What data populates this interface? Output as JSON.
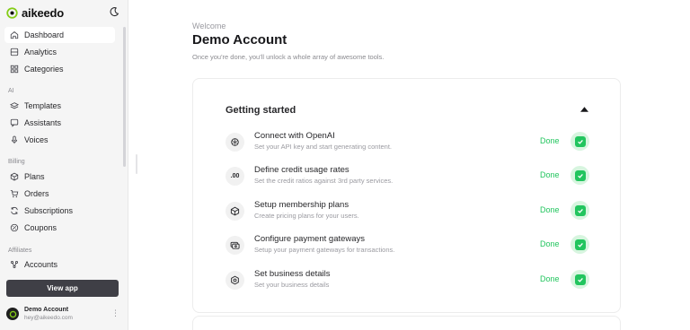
{
  "brand": {
    "name": "aikeedo"
  },
  "sidebar": {
    "items": [
      {
        "label": "Dashboard",
        "icon": "home-icon"
      },
      {
        "label": "Analytics",
        "icon": "chart-icon"
      },
      {
        "label": "Categories",
        "icon": "grid-icon"
      },
      {
        "label": "Templates",
        "icon": "layers-icon"
      },
      {
        "label": "Assistants",
        "icon": "chat-icon"
      },
      {
        "label": "Voices",
        "icon": "mic-icon"
      },
      {
        "label": "Plans",
        "icon": "box-icon"
      },
      {
        "label": "Orders",
        "icon": "cart-icon"
      },
      {
        "label": "Subscriptions",
        "icon": "refresh-icon"
      },
      {
        "label": "Coupons",
        "icon": "coupon-icon"
      },
      {
        "label": "Accounts",
        "icon": "share-icon"
      }
    ],
    "sections": {
      "ai": "AI",
      "billing": "Billing",
      "affiliates": "Affiliates"
    },
    "view_app": "View app",
    "user": {
      "name": "Demo Account",
      "email": "hey@aikeedo.com"
    }
  },
  "main": {
    "welcome": "Welcome",
    "title": "Demo Account",
    "subtitle": "Once you're done, you'll unlock a whole array of awesome tools.",
    "card_title": "Getting started",
    "tasks": [
      {
        "title": "Connect with OpenAI",
        "desc": "Set your API key and start generating content.",
        "status": "Done",
        "icon": "openai-icon"
      },
      {
        "title": "Define credit usage rates",
        "desc": "Set the credit ratios against 3rd party services.",
        "status": "Done",
        "icon_text": ".00"
      },
      {
        "title": "Setup membership plans",
        "desc": "Create pricing plans for your users.",
        "status": "Done",
        "icon": "box-icon"
      },
      {
        "title": "Configure payment gateways",
        "desc": "Setup your payment gateways for transactions.",
        "status": "Done",
        "icon": "card-icon"
      },
      {
        "title": "Set business details",
        "desc": "Set your business details",
        "status": "Done",
        "icon": "hexagon-icon"
      }
    ]
  },
  "colors": {
    "accent": "#22c55e",
    "accent_soft": "#d7f5df",
    "sidebar_bg": "#f5f5f5",
    "button_dark": "#3f3f46"
  }
}
